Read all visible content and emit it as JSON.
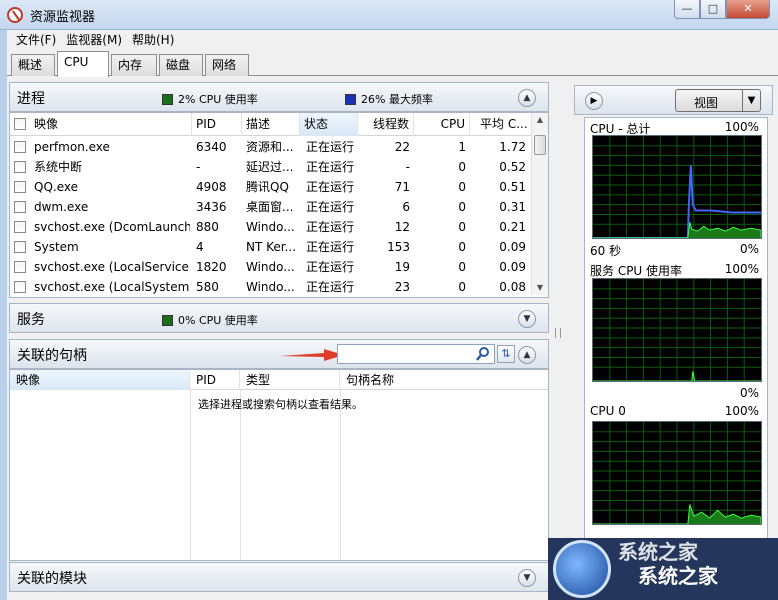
{
  "window": {
    "title": "资源监视器",
    "buttons": {
      "minimize": "—",
      "maximize": "□",
      "close": "✕"
    }
  },
  "menu": [
    "文件(F)",
    "监视器(M)",
    "帮助(H)"
  ],
  "tabs": [
    "概述",
    "CPU",
    "内存",
    "磁盘",
    "网络"
  ],
  "active_tab": "CPU",
  "colors": {
    "cpu_usage": "#1b6e1b",
    "max_freq": "#1a2fb5",
    "graph_bg": "#000000",
    "graph_grid": "#0c5e0c",
    "graph_line": "#3cff3c",
    "freq_line": "#4466ff"
  },
  "processes": {
    "title": "进程",
    "legend_cpu": "2% CPU 使用率",
    "legend_freq": "26% 最大频率",
    "columns": [
      "映像",
      "PID",
      "描述",
      "状态",
      "线程数",
      "CPU",
      "平均 C..."
    ],
    "rows": [
      [
        "perfmon.exe",
        "6340",
        "资源和...",
        "正在运行",
        "22",
        "1",
        "1.72"
      ],
      [
        "系统中断",
        "-",
        "延迟过...",
        "正在运行",
        "-",
        "0",
        "0.52"
      ],
      [
        "QQ.exe",
        "4908",
        "腾讯QQ",
        "正在运行",
        "71",
        "0",
        "0.51"
      ],
      [
        "dwm.exe",
        "3436",
        "桌面窗...",
        "正在运行",
        "6",
        "0",
        "0.31"
      ],
      [
        "svchost.exe (DcomLaunch)",
        "880",
        "Windo...",
        "正在运行",
        "12",
        "0",
        "0.21"
      ],
      [
        "System",
        "4",
        "NT Ker...",
        "正在运行",
        "153",
        "0",
        "0.09"
      ],
      [
        "svchost.exe (LocalServiceN...",
        "1820",
        "Windo...",
        "正在运行",
        "19",
        "0",
        "0.09"
      ],
      [
        "svchost.exe (LocalSystemN...",
        "580",
        "Windo...",
        "正在运行",
        "23",
        "0",
        "0.08"
      ]
    ]
  },
  "services": {
    "title": "服务",
    "legend_cpu": "0% CPU 使用率"
  },
  "handles": {
    "title": "关联的句柄",
    "search_value": "",
    "columns": [
      "映像",
      "PID",
      "类型",
      "句柄名称"
    ],
    "empty_message": "选择进程或搜索句柄以查看结果。"
  },
  "modules": {
    "title": "关联的模块"
  },
  "right_pane": {
    "view_label": "视图",
    "graphs": [
      {
        "title": "CPU - 总计",
        "max": "100%",
        "time": "60 秒",
        "min": "0%"
      },
      {
        "title": "服务 CPU 使用率",
        "max": "100%",
        "min": "0%"
      },
      {
        "title": "CPU 0",
        "max": "100%"
      }
    ]
  },
  "watermark": {
    "text": "系统之家",
    "top_text": "系统之家"
  }
}
